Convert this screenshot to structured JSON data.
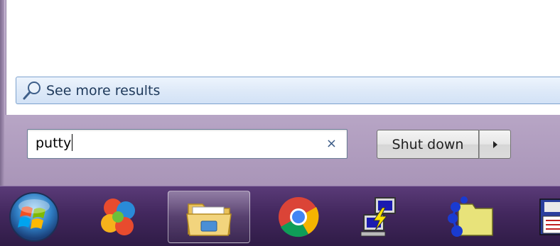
{
  "start_menu": {
    "see_more_label": "See more results",
    "search_value": "putty",
    "clear_symbol": "×",
    "shutdown_label": "Shut down",
    "shutdown_arrow": "▸"
  },
  "taskbar": {
    "items": [
      {
        "name": "start-orb",
        "icon": "windows-logo-icon"
      },
      {
        "name": "pinned-app",
        "icon": "colorful-petals-icon"
      },
      {
        "name": "windows-explorer",
        "icon": "folder-icon",
        "active": true
      },
      {
        "name": "google-chrome",
        "icon": "chrome-icon"
      },
      {
        "name": "putty",
        "icon": "putty-icon"
      },
      {
        "name": "network-folder",
        "icon": "network-folder-icon"
      },
      {
        "name": "partial-app",
        "icon": "floppy-document-icon"
      }
    ]
  },
  "colors": {
    "accent_blue": "#7da2ce",
    "taskbar": "#43285e"
  }
}
